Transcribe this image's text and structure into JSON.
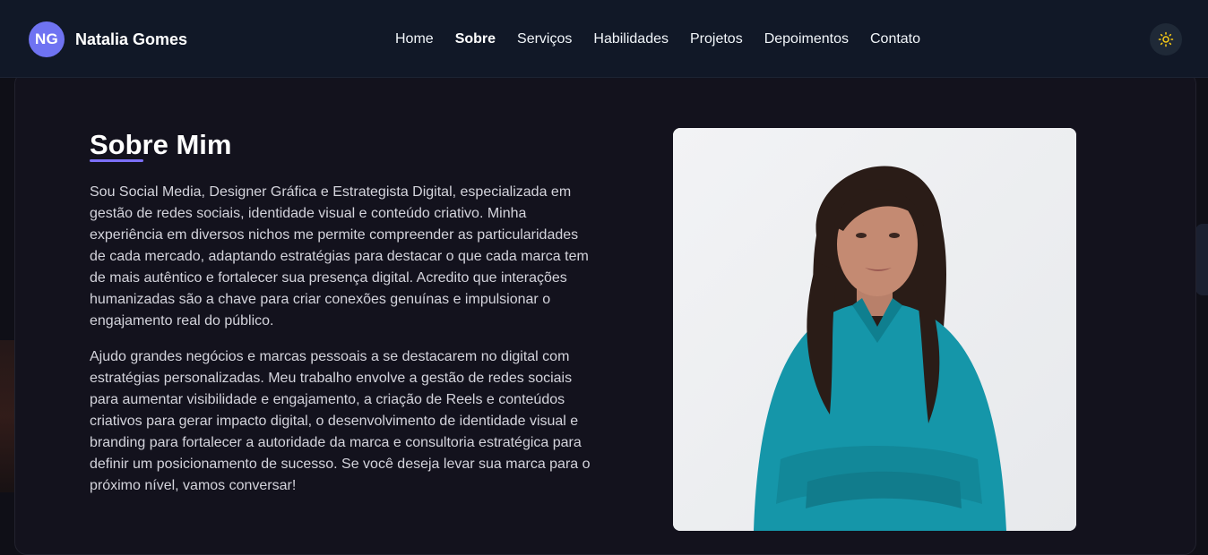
{
  "header": {
    "avatar_initials": "NG",
    "brand_name": "Natalia Gomes",
    "nav": [
      {
        "label": "Home",
        "active": false
      },
      {
        "label": "Sobre",
        "active": true
      },
      {
        "label": "Serviços",
        "active": false
      },
      {
        "label": "Habilidades",
        "active": false
      },
      {
        "label": "Projetos",
        "active": false
      },
      {
        "label": "Depoimentos",
        "active": false
      },
      {
        "label": "Contato",
        "active": false
      }
    ],
    "theme_toggle_icon": "sun-icon"
  },
  "about": {
    "title": "Sobre Mim",
    "paragraph1": "Sou Social Media, Designer Gráfica e Estrategista Digital, especializada em gestão de redes sociais, identidade visual e conteúdo criativo. Minha experiência em diversos nichos me permite compreender as particularidades de cada mercado, adaptando estratégias para destacar o que cada marca tem de mais autêntico e fortalecer sua presença digital. Acredito que interações humanizadas são a chave para criar conexões genuínas e impulsionar o engajamento real do público.",
    "paragraph2": "Ajudo grandes negócios e marcas pessoais a se destacarem no digital com estratégias personalizadas. Meu trabalho envolve a gestão de redes sociais para aumentar visibilidade e engajamento, a criação de Reels e conteúdos criativos para gerar impacto digital, o desenvolvimento de identidade visual e branding para fortalecer a autoridade da marca e consultoria estratégica para definir um posicionamento de sucesso. Se você deseja levar sua marca para o próximo nível, vamos conversar!"
  },
  "colors": {
    "accent": "#7c6ff7",
    "avatar_bg": "#6f73f2",
    "navbar_bg": "#111827",
    "card_bg": "#13121d",
    "sun_icon": "#facc15"
  }
}
